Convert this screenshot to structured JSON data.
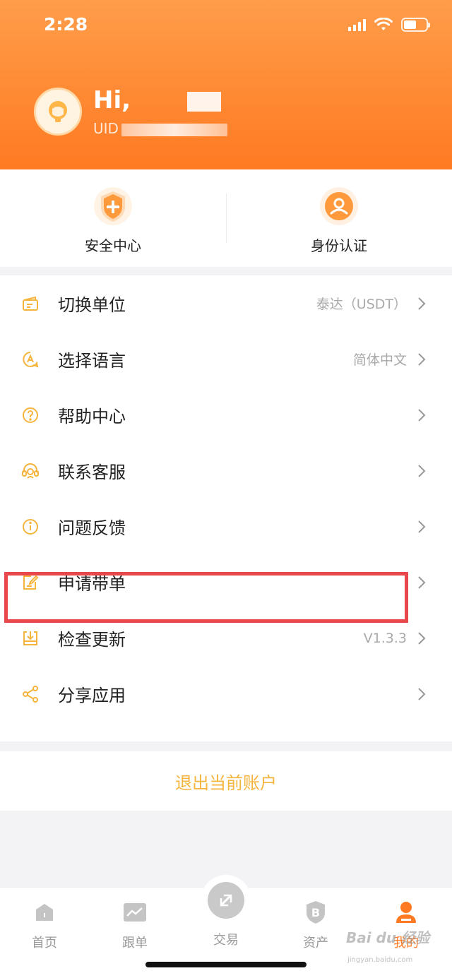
{
  "status_bar": {
    "time": "2:28"
  },
  "profile": {
    "greeting": "Hi,",
    "uid_prefix": "UID"
  },
  "quick_actions": [
    {
      "label": "安全中心",
      "icon": "shield-plus-icon"
    },
    {
      "label": "身份认证",
      "icon": "person-badge-icon"
    }
  ],
  "menu": [
    {
      "label": "切换单位",
      "value": "泰达（USDT）",
      "icon": "wallet-card-icon"
    },
    {
      "label": "选择语言",
      "value": "简体中文",
      "icon": "language-icon"
    },
    {
      "label": "帮助中心",
      "value": "",
      "icon": "help-circle-icon"
    },
    {
      "label": "联系客服",
      "value": "",
      "icon": "headset-icon"
    },
    {
      "label": "问题反馈",
      "value": "",
      "icon": "info-circle-icon"
    },
    {
      "label": "申请带单",
      "value": "",
      "icon": "edit-document-icon"
    },
    {
      "label": "检查更新",
      "value": "V1.3.3",
      "icon": "update-download-icon"
    },
    {
      "label": "分享应用",
      "value": "",
      "icon": "share-icon"
    }
  ],
  "logout_label": "退出当前账户",
  "tabbar": [
    {
      "label": "首页",
      "icon": "home-icon"
    },
    {
      "label": "跟单",
      "icon": "trend-chart-icon"
    },
    {
      "label": "交易",
      "icon": "swap-icon"
    },
    {
      "label": "资产",
      "icon": "bitcoin-shield-icon"
    },
    {
      "label": "我的",
      "icon": "user-icon"
    }
  ],
  "watermark": {
    "text": "Bai du 经验",
    "sub": "jingyan.baidu.com"
  },
  "colors": {
    "brand_orange": "#ff7a22",
    "accent_yellow": "#f5b43d",
    "highlight_red": "#e8484c"
  }
}
